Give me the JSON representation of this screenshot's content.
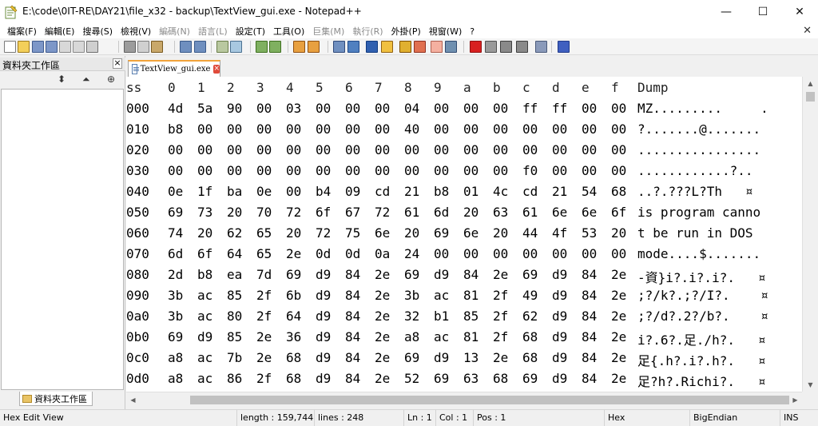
{
  "window": {
    "title": "E:\\code\\0IT-RE\\DAY21\\file_x32 - backup\\TextView_gui.exe - Notepad++",
    "minimize": "—",
    "maximize": "☐",
    "close": "✕"
  },
  "menu": {
    "items": [
      {
        "label": "檔案(F)",
        "disabled": false
      },
      {
        "label": "編輯(E)",
        "disabled": false
      },
      {
        "label": "搜尋(S)",
        "disabled": false
      },
      {
        "label": "檢視(V)",
        "disabled": false
      },
      {
        "label": "編碼(N)",
        "disabled": true
      },
      {
        "label": "語言(L)",
        "disabled": true
      },
      {
        "label": "設定(T)",
        "disabled": false
      },
      {
        "label": "工具(O)",
        "disabled": false
      },
      {
        "label": "巨集(M)",
        "disabled": true
      },
      {
        "label": "執行(R)",
        "disabled": true
      },
      {
        "label": "外掛(P)",
        "disabled": false
      },
      {
        "label": "視窗(W)",
        "disabled": false
      },
      {
        "label": "?",
        "disabled": false
      }
    ],
    "close_glyph": "✕"
  },
  "left_panel": {
    "title": "資料夾工作區",
    "close_glyph": "×",
    "tool_glyphs": [
      "⬍",
      "⏶",
      "⊕"
    ],
    "bottom_tab": "資料夾工作區"
  },
  "tab": {
    "label": "TextView_gui.exe",
    "close_glyph": "×"
  },
  "hex": {
    "header": {
      "addr": "ss",
      "cols": [
        "0",
        "1",
        "2",
        "3",
        "4",
        "5",
        "6",
        "7",
        "8",
        "9",
        "a",
        "b",
        "c",
        "d",
        "e",
        "f"
      ],
      "dump": "Dump"
    },
    "rows": [
      {
        "addr": "000",
        "bytes": [
          "4d",
          "5a",
          "90",
          "00",
          "03",
          "00",
          "00",
          "00",
          "04",
          "00",
          "00",
          "00",
          "ff",
          "ff",
          "00",
          "00"
        ],
        "dump": "MZ.........     ."
      },
      {
        "addr": "010",
        "bytes": [
          "b8",
          "00",
          "00",
          "00",
          "00",
          "00",
          "00",
          "00",
          "40",
          "00",
          "00",
          "00",
          "00",
          "00",
          "00",
          "00"
        ],
        "dump": "?.......@......."
      },
      {
        "addr": "020",
        "bytes": [
          "00",
          "00",
          "00",
          "00",
          "00",
          "00",
          "00",
          "00",
          "00",
          "00",
          "00",
          "00",
          "00",
          "00",
          "00",
          "00"
        ],
        "dump": "................"
      },
      {
        "addr": "030",
        "bytes": [
          "00",
          "00",
          "00",
          "00",
          "00",
          "00",
          "00",
          "00",
          "00",
          "00",
          "00",
          "00",
          "f0",
          "00",
          "00",
          "00"
        ],
        "dump": "............?.."
      },
      {
        "addr": "040",
        "bytes": [
          "0e",
          "1f",
          "ba",
          "0e",
          "00",
          "b4",
          "09",
          "cd",
          "21",
          "b8",
          "01",
          "4c",
          "cd",
          "21",
          "54",
          "68"
        ],
        "dump": "..?.???L?Th   ¤"
      },
      {
        "addr": "050",
        "bytes": [
          "69",
          "73",
          "20",
          "70",
          "72",
          "6f",
          "67",
          "72",
          "61",
          "6d",
          "20",
          "63",
          "61",
          "6e",
          "6e",
          "6f"
        ],
        "dump": "is program canno"
      },
      {
        "addr": "060",
        "bytes": [
          "74",
          "20",
          "62",
          "65",
          "20",
          "72",
          "75",
          "6e",
          "20",
          "69",
          "6e",
          "20",
          "44",
          "4f",
          "53",
          "20"
        ],
        "dump": "t be run in DOS"
      },
      {
        "addr": "070",
        "bytes": [
          "6d",
          "6f",
          "64",
          "65",
          "2e",
          "0d",
          "0d",
          "0a",
          "24",
          "00",
          "00",
          "00",
          "00",
          "00",
          "00",
          "00"
        ],
        "dump": "mode....$......."
      },
      {
        "addr": "080",
        "bytes": [
          "2d",
          "b8",
          "ea",
          "7d",
          "69",
          "d9",
          "84",
          "2e",
          "69",
          "d9",
          "84",
          "2e",
          "69",
          "d9",
          "84",
          "2e"
        ],
        "dump": "-資}i?.i?.i?.   ¤"
      },
      {
        "addr": "090",
        "bytes": [
          "3b",
          "ac",
          "85",
          "2f",
          "6b",
          "d9",
          "84",
          "2e",
          "3b",
          "ac",
          "81",
          "2f",
          "49",
          "d9",
          "84",
          "2e"
        ],
        "dump": ";?/k?.;?/I?.    ¤"
      },
      {
        "addr": "0a0",
        "bytes": [
          "3b",
          "ac",
          "80",
          "2f",
          "64",
          "d9",
          "84",
          "2e",
          "32",
          "b1",
          "85",
          "2f",
          "62",
          "d9",
          "84",
          "2e"
        ],
        "dump": ";?/d?.2?/b?.    ¤"
      },
      {
        "addr": "0b0",
        "bytes": [
          "69",
          "d9",
          "85",
          "2e",
          "36",
          "d9",
          "84",
          "2e",
          "a8",
          "ac",
          "81",
          "2f",
          "68",
          "d9",
          "84",
          "2e"
        ],
        "dump": "i?.6?.足./h?.   ¤"
      },
      {
        "addr": "0c0",
        "bytes": [
          "a8",
          "ac",
          "7b",
          "2e",
          "68",
          "d9",
          "84",
          "2e",
          "69",
          "d9",
          "13",
          "2e",
          "68",
          "d9",
          "84",
          "2e"
        ],
        "dump": "足{.h?.i?.h?.   ¤"
      },
      {
        "addr": "0d0",
        "bytes": [
          "a8",
          "ac",
          "86",
          "2f",
          "68",
          "d9",
          "84",
          "2e",
          "52",
          "69",
          "63",
          "68",
          "69",
          "d9",
          "84",
          "2e"
        ],
        "dump": "足?h?.Richi?.   ¤"
      }
    ]
  },
  "status": {
    "mode": "Hex Edit View",
    "length": "length : 159,744",
    "lines": "lines : 248",
    "ln": "Ln : 1",
    "col": "Col : 1",
    "pos": "Pos : 1",
    "view": "Hex",
    "endian": "BigEndian",
    "ins": "INS"
  },
  "colors": {
    "tab_accent": "#f2a33a",
    "tab_close": "#e04a3a",
    "editor_bg": "#ffffff",
    "chrome_bg": "#f0f0f0"
  }
}
